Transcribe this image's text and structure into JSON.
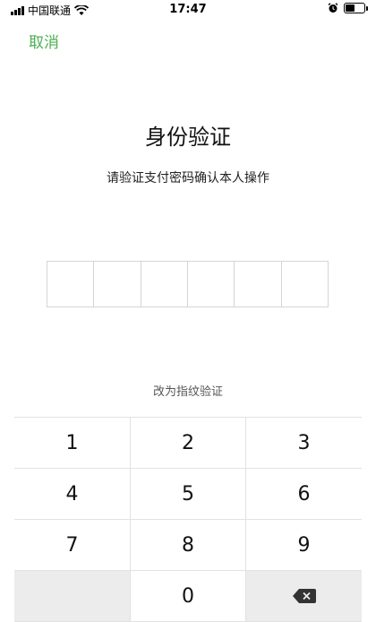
{
  "status_bar": {
    "carrier": "中国联通",
    "time": "17:47",
    "battery_level": 0.5
  },
  "header": {
    "cancel_label": "取消"
  },
  "main": {
    "title": "身份验证",
    "subtitle": "请验证支付密码确认本人操作",
    "pin_length": 6,
    "switch_label": "改为指纹验证"
  },
  "keypad": {
    "keys": [
      "1",
      "2",
      "3",
      "4",
      "5",
      "6",
      "7",
      "8",
      "9",
      "",
      "0",
      "delete-icon"
    ]
  },
  "colors": {
    "accent": "#4caf50",
    "keypad_gray": "#ececec"
  }
}
